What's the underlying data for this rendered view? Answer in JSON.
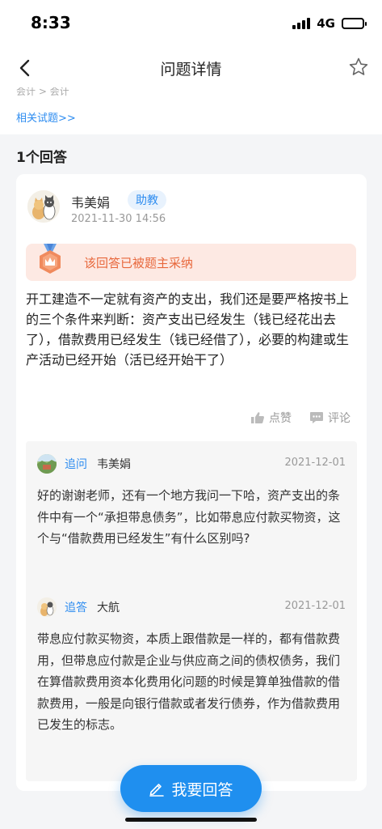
{
  "status_bar": {
    "time": "8:33",
    "network": "4G",
    "battery": 1.0
  },
  "nav": {
    "title": "问题详情",
    "back_icon": "chevron-left-icon",
    "favorite_icon": "star-outline-icon"
  },
  "question": {
    "category_text": "会计 > 会计",
    "related_link": "相关试题>>"
  },
  "answers_count_label": "1个回答",
  "answer": {
    "author": "韦美娟",
    "role": "助教",
    "time": "2021-11-30 14:56",
    "adopted_text": "该回答已被题主采纳",
    "body": "开工建造不一定就有资产的支出，我们还是要严格按书上的三个条件来判断：资产支出已经发生（钱已经花出去了），借款费用已经发生（钱已经借了），必要的构建或生产活动已经开始（活已经开始干了）",
    "like_label": "点赞",
    "comment_label": "评论"
  },
  "thread": [
    {
      "tag": "追问",
      "user": "韦美娟",
      "date": "2021-12-01",
      "body": "好的谢谢老师，还有一个地方我问一下哈，资产支出的条件中有一个“承担带息债务”，比如带息应付款买物资，这个与“借款费用已经发生”有什么区别吗?"
    },
    {
      "tag": "追答",
      "user": "大航",
      "date": "2021-12-01",
      "body": "带息应付款买物资，本质上跟借款是一样的，都有借款费用，但带息应付款是企业与供应商之间的债权债务，我们在算借款费用资本化费用化问题的时候是算单独借款的借款费用，一般是向银行借款或者发行债券，作为借款费用已发生的标志。"
    }
  ],
  "answer_button": {
    "label": "我要回答",
    "icon": "edit-icon"
  },
  "colors": {
    "accent": "#1f8fef",
    "link": "#2d8cf0",
    "adopted_bg": "#fde9e3",
    "adopted_text": "#e8683c"
  }
}
